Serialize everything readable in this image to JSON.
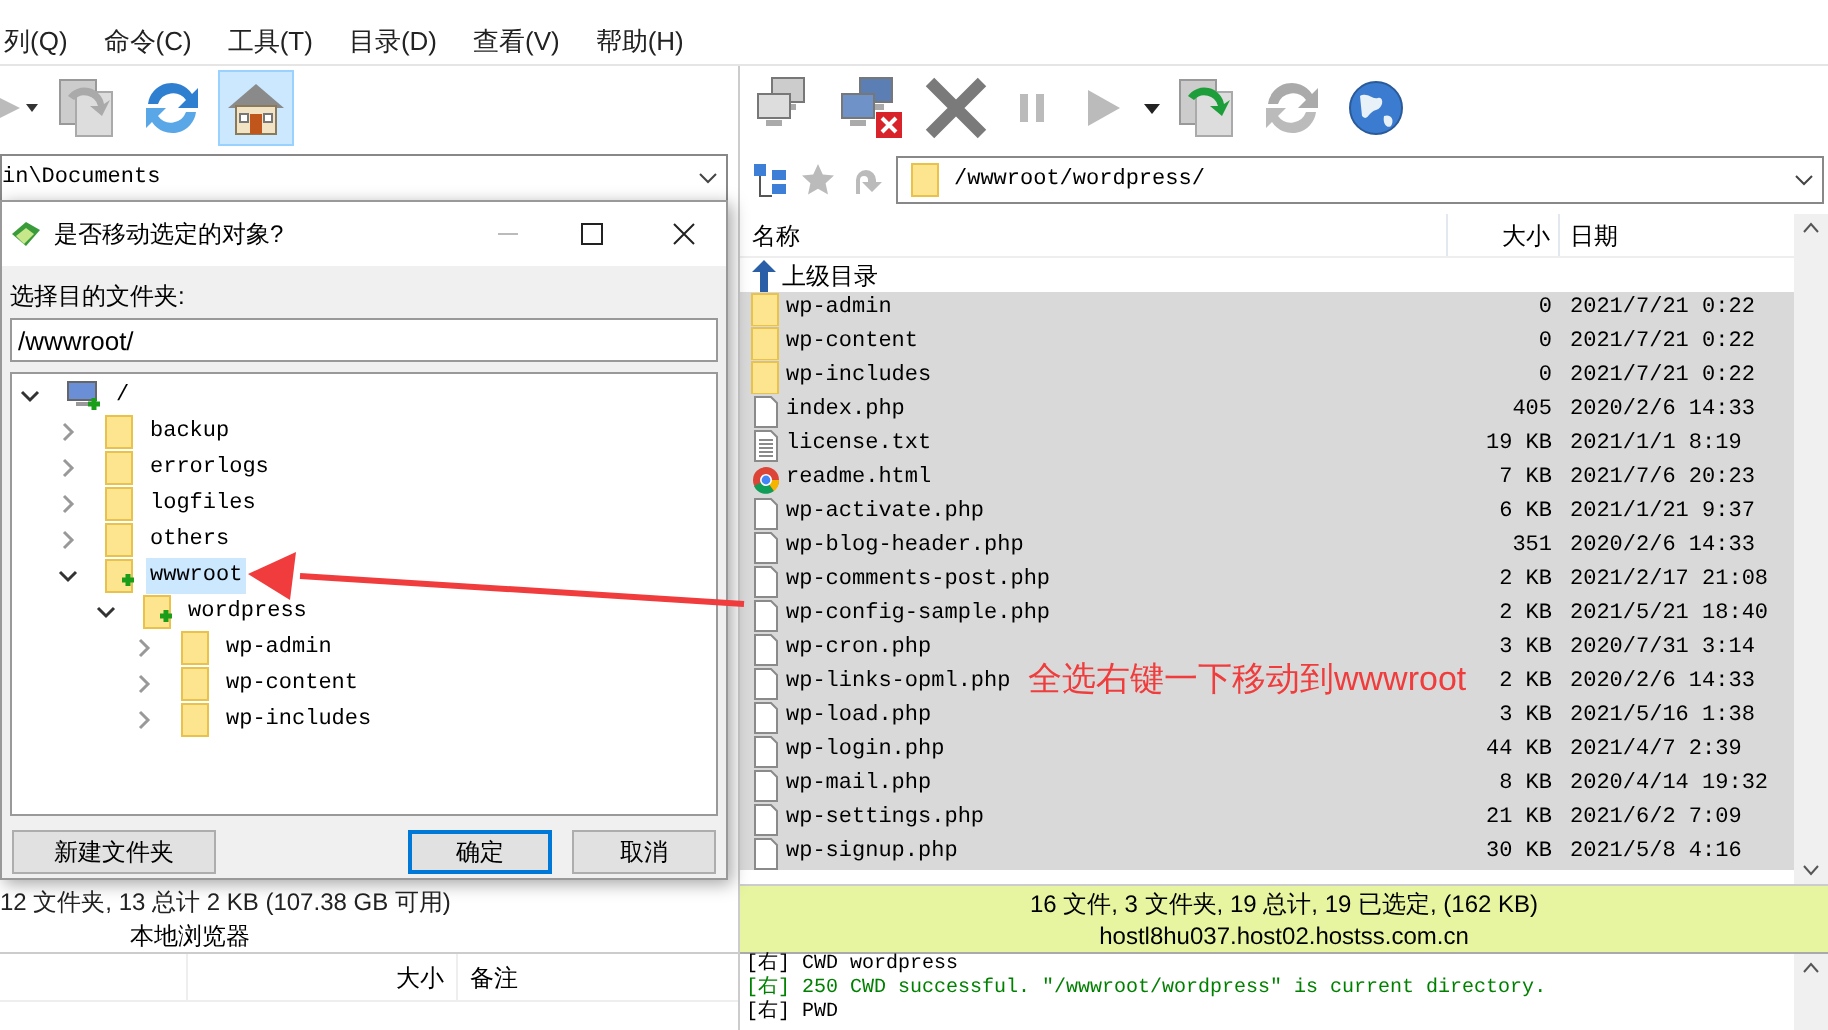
{
  "menu": [
    "列(Q)",
    "命令(C)",
    "工具(T)",
    "目录(D)",
    "查看(V)",
    "帮助(H)"
  ],
  "left": {
    "path": "in\\Documents",
    "status": "12 文件夹, 13 总计 2 KB (107.38 GB 可用)",
    "label": "本地浏览器",
    "queue_columns": [
      "大小",
      "备注"
    ]
  },
  "dialog": {
    "title": "是否移动选定的对象?",
    "prompt": "选择目的文件夹:",
    "value": "/wwwroot/",
    "tree": [
      {
        "label": "/",
        "kind": "drive",
        "expanded": true,
        "selected": false,
        "children": [
          {
            "label": "backup",
            "kind": "folder",
            "expanded": false,
            "selected": false
          },
          {
            "label": "errorlogs",
            "kind": "folder",
            "expanded": false,
            "selected": false
          },
          {
            "label": "logfiles",
            "kind": "folder",
            "expanded": false,
            "selected": false
          },
          {
            "label": "others",
            "kind": "folder",
            "expanded": false,
            "selected": false
          },
          {
            "label": "wwwroot",
            "kind": "folder",
            "expanded": true,
            "selected": true,
            "children": [
              {
                "label": "wordpress",
                "kind": "folder",
                "expanded": true,
                "selected": false,
                "children": [
                  {
                    "label": "wp-admin",
                    "kind": "folder",
                    "expanded": false,
                    "selected": false
                  },
                  {
                    "label": "wp-content",
                    "kind": "folder",
                    "expanded": false,
                    "selected": false
                  },
                  {
                    "label": "wp-includes",
                    "kind": "folder",
                    "expanded": false,
                    "selected": false
                  }
                ]
              }
            ]
          }
        ]
      }
    ],
    "buttons": [
      {
        "label": "新建文件夹",
        "default": false
      },
      {
        "label": "确定",
        "default": true
      },
      {
        "label": "取消",
        "default": false
      }
    ]
  },
  "right": {
    "path": "/wwwroot/wordpress/",
    "columns": [
      "名称",
      "大小",
      "日期"
    ],
    "parent": "上级目录",
    "files": [
      {
        "name": "wp-admin",
        "kind": "folder",
        "size": "0",
        "date": "2021/7/21 0:22",
        "selected": true
      },
      {
        "name": "wp-content",
        "kind": "folder",
        "size": "0",
        "date": "2021/7/21 0:22",
        "selected": true
      },
      {
        "name": "wp-includes",
        "kind": "folder",
        "size": "0",
        "date": "2021/7/21 0:22",
        "selected": true
      },
      {
        "name": "index.php",
        "kind": "file",
        "size": "405",
        "date": "2020/2/6 14:33",
        "selected": true
      },
      {
        "name": "license.txt",
        "kind": "text",
        "size": "19 KB",
        "date": "2021/1/1 8:19",
        "selected": true
      },
      {
        "name": "readme.html",
        "kind": "web",
        "size": "7 KB",
        "date": "2021/7/6 20:23",
        "selected": true
      },
      {
        "name": "wp-activate.php",
        "kind": "file",
        "size": "6 KB",
        "date": "2021/1/21 9:37",
        "selected": true
      },
      {
        "name": "wp-blog-header.php",
        "kind": "file",
        "size": "351",
        "date": "2020/2/6 14:33",
        "selected": true
      },
      {
        "name": "wp-comments-post.php",
        "kind": "file",
        "size": "2 KB",
        "date": "2021/2/17 21:08",
        "selected": true
      },
      {
        "name": "wp-config-sample.php",
        "kind": "file",
        "size": "2 KB",
        "date": "2021/5/21 18:40",
        "selected": true
      },
      {
        "name": "wp-cron.php",
        "kind": "file",
        "size": "3 KB",
        "date": "2020/7/31 3:14",
        "selected": true
      },
      {
        "name": "wp-links-opml.php",
        "kind": "file",
        "size": "2 KB",
        "date": "2020/2/6 14:33",
        "selected": true,
        "annotation": "全选右键一下移动到wwwroot"
      },
      {
        "name": "wp-load.php",
        "kind": "file",
        "size": "3 KB",
        "date": "2021/5/16 1:38",
        "selected": true
      },
      {
        "name": "wp-login.php",
        "kind": "file",
        "size": "44 KB",
        "date": "2021/4/7 2:39",
        "selected": true
      },
      {
        "name": "wp-mail.php",
        "kind": "file",
        "size": "8 KB",
        "date": "2020/4/14 19:32",
        "selected": true
      },
      {
        "name": "wp-settings.php",
        "kind": "file",
        "size": "21 KB",
        "date": "2021/6/2 7:09",
        "selected": true
      },
      {
        "name": "wp-signup.php",
        "kind": "file",
        "size": "30 KB",
        "date": "2021/5/8 4:16",
        "selected": true
      }
    ],
    "status": "16 文件, 3 文件夹, 19 总计, 19 已选定, (162 KB)",
    "host": "hostl8hu037.host02.hostss.com.cn",
    "log": [
      {
        "text": "[右] CWD wordpress",
        "color": "#000000"
      },
      {
        "text": "[右] 250 CWD successful. \"/wwwroot/wordpress\" is current directory.",
        "color": "#008000"
      },
      {
        "text": "[右] PWD",
        "color": "#000000"
      }
    ]
  }
}
